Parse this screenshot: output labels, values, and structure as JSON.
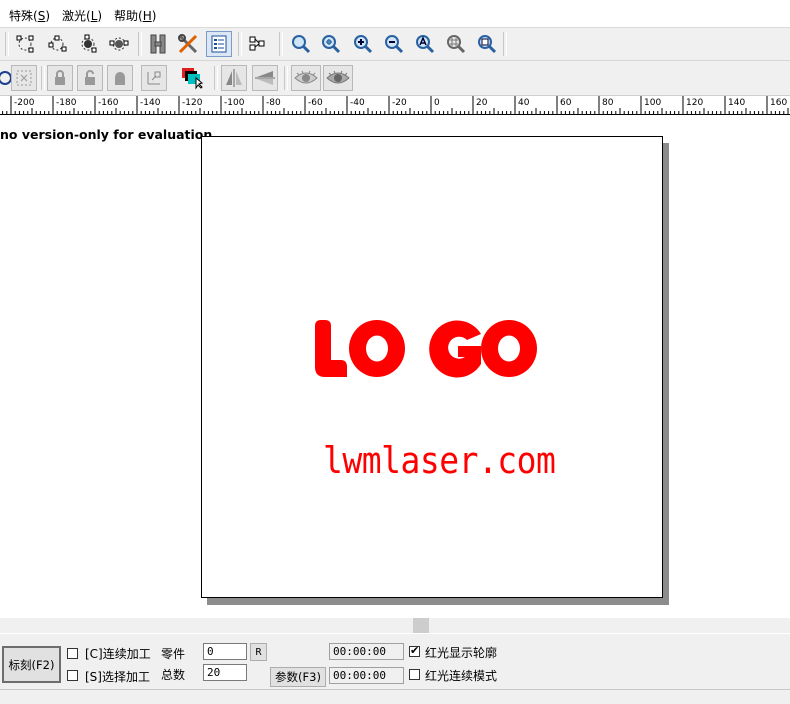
{
  "menu": [
    {
      "label": "特殊(",
      "key": "S",
      "end": ")"
    },
    {
      "label": "激光(",
      "key": "L",
      "end": ")"
    },
    {
      "label": "帮助(",
      "key": "H",
      "end": ")"
    }
  ],
  "toolbar1_icons": [
    "node-edit-icon",
    "node-add-icon",
    "node-delete-icon",
    "node-break-icon",
    "h-hatch-icon",
    "tools-icon",
    "object-list-icon",
    "group-icon",
    "zoom-icon",
    "zoom-in-icon",
    "zoom-plus-icon",
    "zoom-minus-icon",
    "zoom-all-icon",
    "zoom-grid-icon",
    "zoom-page-icon"
  ],
  "toolbar2_icons": [
    "rotate-icon",
    "grid-select-icon",
    "lock-icon",
    "unlock-icon",
    "lock-shape-icon",
    "align-icon",
    "color-icon",
    "mirror-horizontal-icon",
    "mirror-vertical-icon",
    "eye-icon",
    "eye-hatch-icon"
  ],
  "ruler": {
    "ticks": [
      "-200",
      "-180",
      "-160",
      "-140",
      "-120",
      "-100",
      "-80",
      "-60",
      "-40",
      "-20",
      "0",
      "20",
      "40",
      "60",
      "80",
      "100",
      "120",
      "140",
      "160"
    ]
  },
  "canvas": {
    "demo_notice": "no version-only for evaluation",
    "logo_text": "LOGO",
    "url_text": "lwmlaser.com",
    "content_color": "#ff0000"
  },
  "bottom": {
    "mark_button": "标刻(F2)",
    "continuous_label": "[C]连续加工",
    "select_label": "[S]选择加工",
    "parts_label": "零件",
    "total_label": "总数",
    "parts_value": "0",
    "total_value": "20",
    "reset_button": "R",
    "params_button": "参数(F3)",
    "time1": "00:00:00",
    "time2": "00:00:00",
    "red_outline_label": "红光显示轮廓",
    "red_continuous_label": "红光连续模式"
  }
}
